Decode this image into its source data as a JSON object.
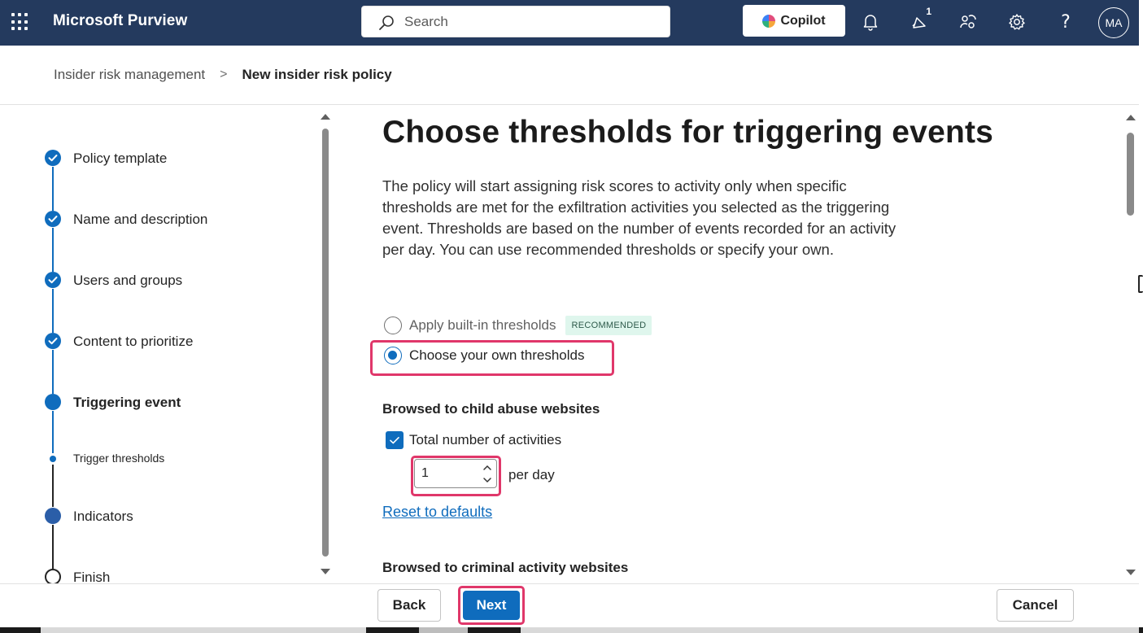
{
  "app": {
    "title": "Microsoft Purview",
    "search_placeholder": "Search",
    "copilot_label": "Copilot",
    "notification_count": "1",
    "help_glyph": "?",
    "avatar_initials": "MA",
    "accent_color": "#0f6cbd",
    "header_color": "#243a5e",
    "highlight_color": "#e0376a"
  },
  "breadcrumb": {
    "parent": "Insider risk management",
    "separator": ">",
    "current": "New insider risk policy"
  },
  "stepper": {
    "steps": [
      {
        "label": "Policy template",
        "state": "completed"
      },
      {
        "label": "Name and description",
        "state": "completed"
      },
      {
        "label": "Users and groups",
        "state": "completed"
      },
      {
        "label": "Content to prioritize",
        "state": "completed"
      },
      {
        "label": "Triggering event",
        "state": "current"
      },
      {
        "label": "Trigger thresholds",
        "state": "current-substep"
      },
      {
        "label": "Indicators",
        "state": "upcoming"
      },
      {
        "label": "Finish",
        "state": "not-started"
      }
    ]
  },
  "main": {
    "heading": "Choose thresholds for triggering events",
    "description": "The policy will start assigning risk scores to activity only when specific thresholds are met for the exfiltration activities you selected as the triggering event. Thresholds are based on the number of events recorded for an activity per day. You can use recommended thresholds or specify your own.",
    "options": [
      {
        "label": "Apply built-in thresholds",
        "badge": "RECOMMENDED",
        "selected": false
      },
      {
        "label": "Choose your own thresholds",
        "selected": true
      }
    ],
    "section1": {
      "title": "Browsed to child abuse websites",
      "checkbox_label": "Total number of activities",
      "checked": true,
      "value": "1",
      "unit": "per day",
      "reset_label": "Reset to defaults"
    },
    "section2": {
      "title": "Browsed to criminal activity websites"
    }
  },
  "footer": {
    "back_label": "Back",
    "next_label": "Next",
    "cancel_label": "Cancel"
  }
}
